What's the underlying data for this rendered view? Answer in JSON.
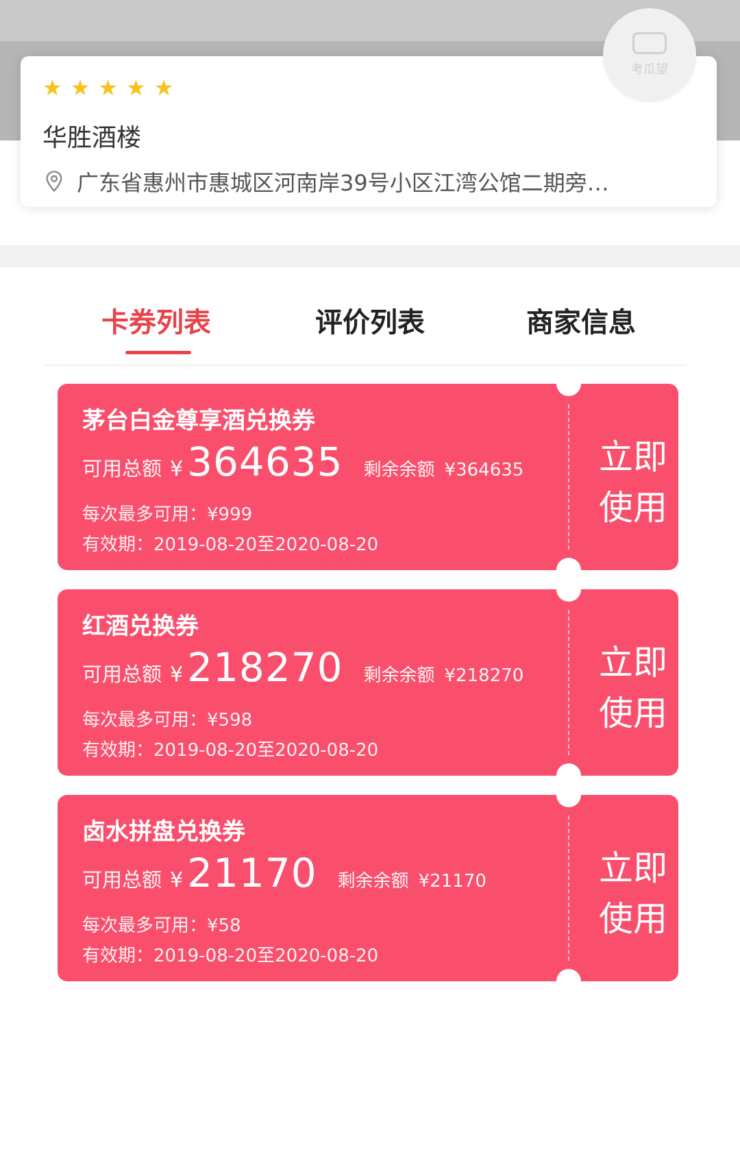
{
  "shop": {
    "rating_stars": 5,
    "name": "华胜酒楼",
    "address": "广东省惠州市惠城区河南岸39号小区江湾公馆二期旁…",
    "logo_text": "考瓜望"
  },
  "tabs": [
    {
      "label": "卡券列表",
      "active": true
    },
    {
      "label": "评价列表",
      "active": false
    },
    {
      "label": "商家信息",
      "active": false
    }
  ],
  "colors": {
    "accent": "#e8434a",
    "coupon": "#fa4f6c",
    "star": "#f6c21c"
  },
  "coupons": [
    {
      "title": "茅台白金尊享酒兑换券",
      "total_label": "可用总额",
      "currency": "¥",
      "total": "364635",
      "remain_label": "剩余余额",
      "remain": "¥364635",
      "max_label": "每次最多可用：",
      "max": "¥999",
      "valid_label": "有效期：",
      "valid": "2019-08-20至2020-08-20",
      "button_line1": "立即",
      "button_line2": "使用"
    },
    {
      "title": "红酒兑换券",
      "total_label": "可用总额",
      "currency": "¥",
      "total": "218270",
      "remain_label": "剩余余额",
      "remain": "¥218270",
      "max_label": "每次最多可用：",
      "max": "¥598",
      "valid_label": "有效期：",
      "valid": "2019-08-20至2020-08-20",
      "button_line1": "立即",
      "button_line2": "使用"
    },
    {
      "title": "卤水拼盘兑换券",
      "total_label": "可用总额",
      "currency": "¥",
      "total": "21170",
      "remain_label": "剩余余额",
      "remain": "¥21170",
      "max_label": "每次最多可用：",
      "max": "¥58",
      "valid_label": "有效期：",
      "valid": "2019-08-20至2020-08-20",
      "button_line1": "立即",
      "button_line2": "使用"
    }
  ]
}
